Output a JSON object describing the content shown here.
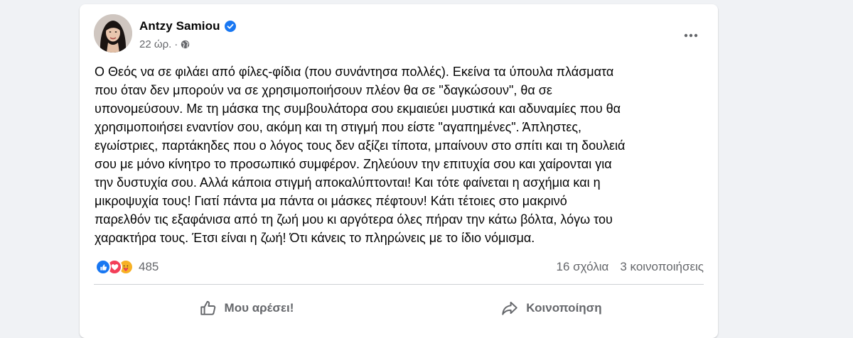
{
  "post": {
    "author_name": "Antzy Samiou",
    "verified_icon": "verified-badge-icon",
    "timestamp": "22 ώρ.",
    "separator": "·",
    "audience_icon": "globe-icon",
    "more_icon": "more-options-icon",
    "text": "Ο Θεός να σε φιλάει από φίλες-φίδια (που συνάντησα πολλές). Εκείνα τα ύπουλα πλάσματα\nπου όταν δεν μπορούν να σε χρησιμοποιήσουν πλέον θα σε \"δαγκώσουν\", θα σε\nυπονομεύσουν. Με τη μάσκα της συμβουλάτορα σου εκμαιεύει μυστικά και αδυναμίες που θα\nχρησιμοποιήσει εναντίον σου, ακόμη και τη στιγμή που είστε \"αγαπημένες\". Άπληστες,\nεγωίστριες, παρτάκηδες που ο λόγος τους δεν αξίζει τίποτα, μπαίνουν στο σπίτι και τη δουλειά\nσου με μόνο κίνητρο το προσωπικό συμφέρον. Ζηλεύουν την επιτυχία σου και χαίρονται για\nτην δυστυχία σου. Αλλά κάποια στιγμή αποκαλύπτονται! Και τότε φαίνεται η ασχήμια και η\nμικροψυχία τους! Γιατί πάντα μα πάντα οι μάσκες πέφτουν! Κάτι τέτοιες στο μακρινό\nπαρελθόν τις εξαφάνισα από τη ζωή μου κι αργότερα όλες πήραν την κάτω βόλτα, λόγω του\nχαρακτήρα τους. Έτσι είναι η ζωή! Ότι κάνεις το πληρώνεις με το ίδιο νόμισμα."
  },
  "stats": {
    "reaction_icons": [
      "like-reaction-icon",
      "love-reaction-icon",
      "care-reaction-icon"
    ],
    "reaction_count": "485",
    "comments": "16 σχόλια",
    "shares": "3 κοινοποιήσεις"
  },
  "actions": {
    "like_label": "Μου αρέσει!",
    "share_label": "Κοινοποίηση"
  },
  "colors": {
    "background": "#f0f2f5",
    "card": "#ffffff",
    "secondary_text": "#65676b",
    "like_blue": "#1877f2",
    "love_red": "#f33e58",
    "care_yellow": "#f7b125",
    "divider": "#ced0d4"
  }
}
